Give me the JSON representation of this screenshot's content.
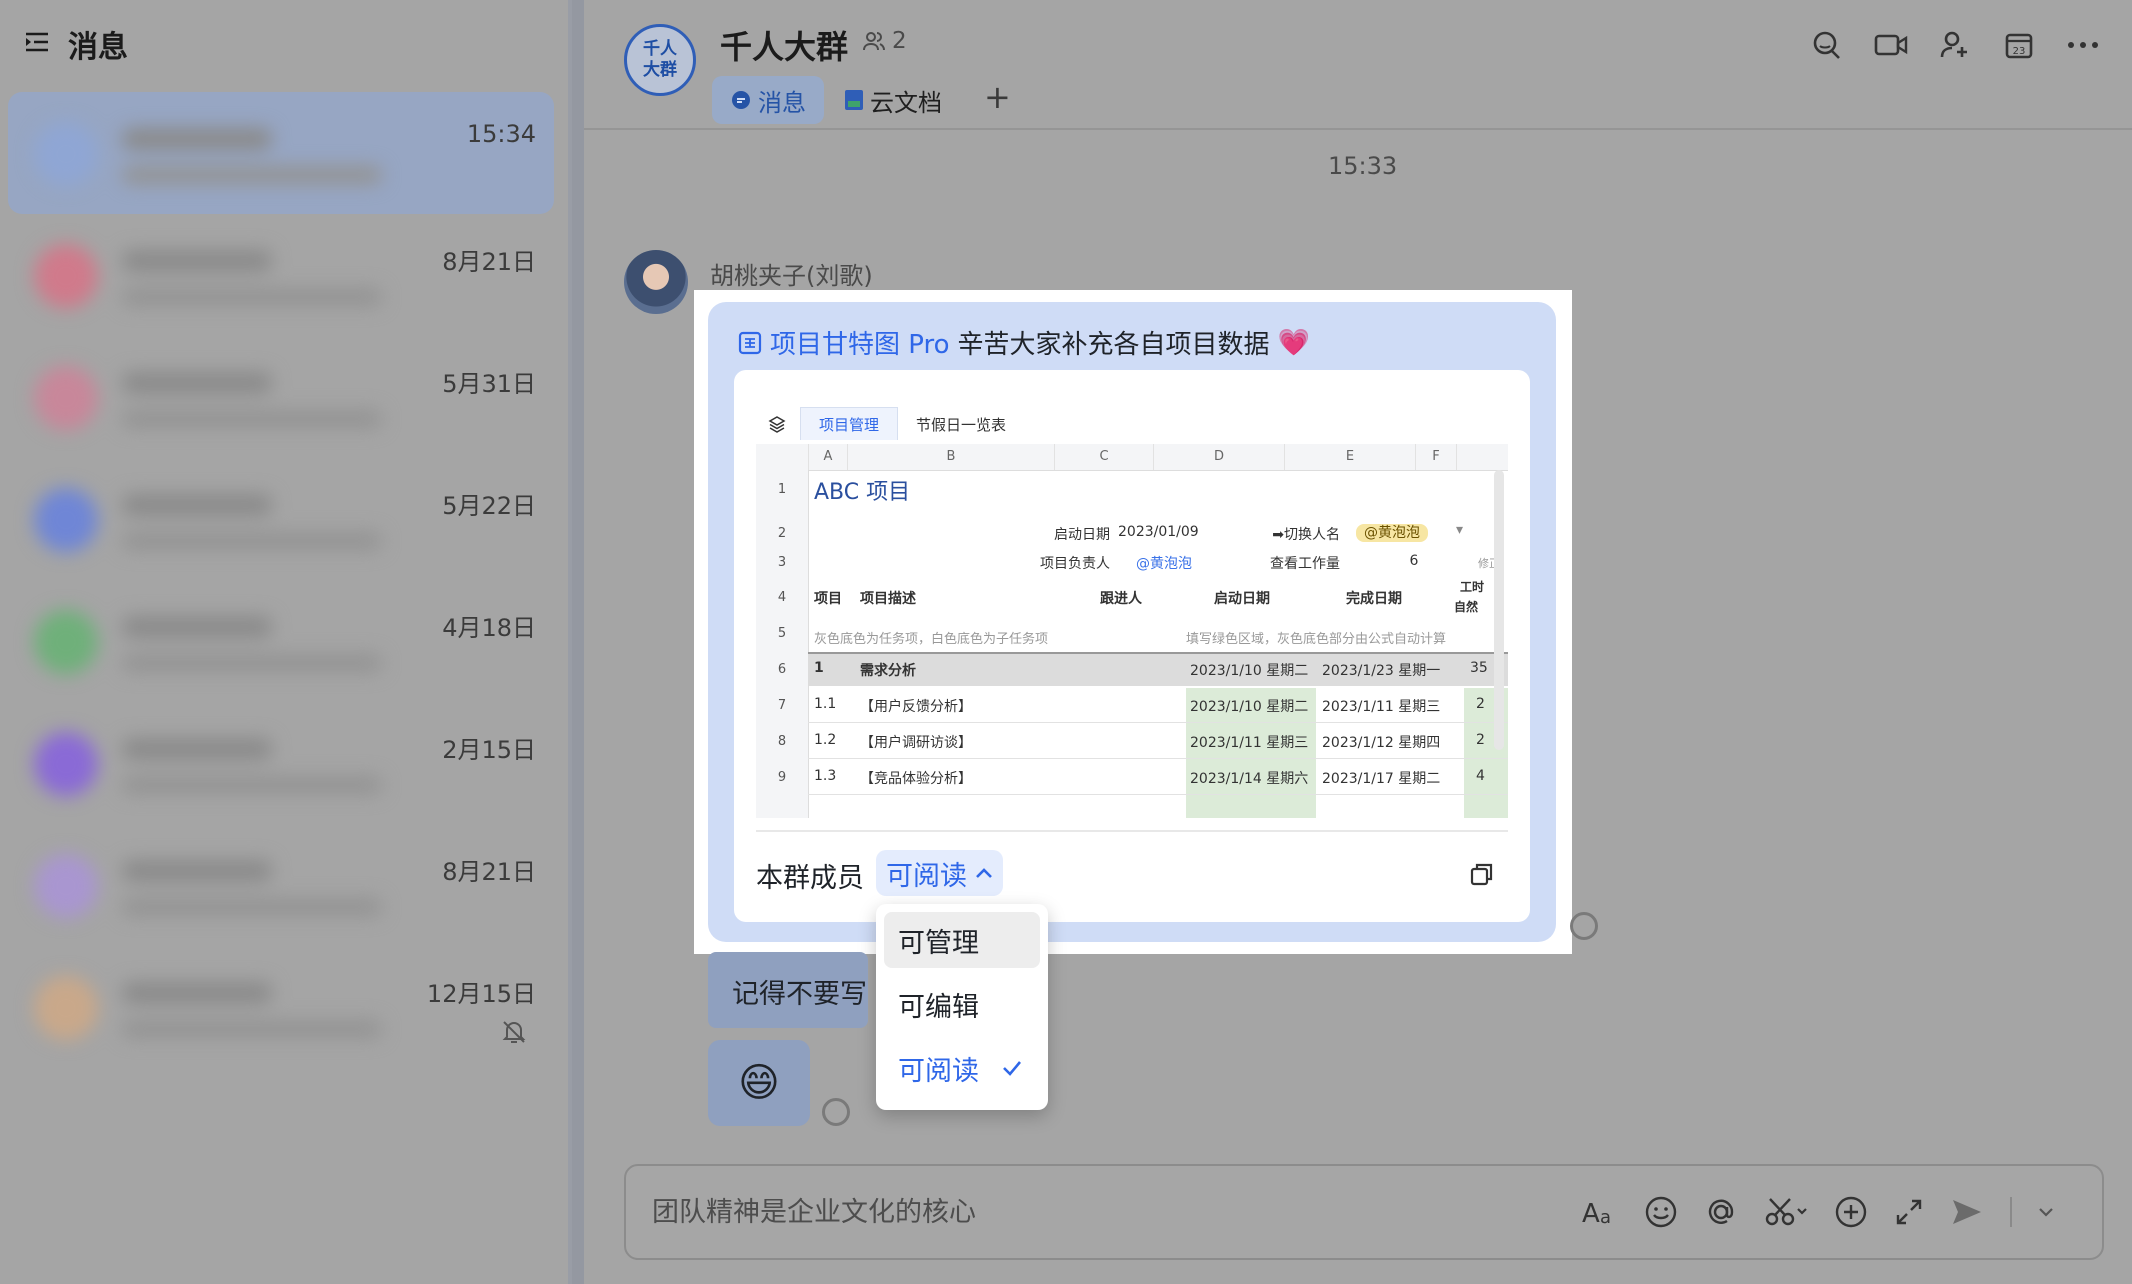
{
  "left": {
    "title": "消息",
    "chats": [
      {
        "time": "15:34",
        "active": true,
        "avatar": "#8fa6d4"
      },
      {
        "time": "8月21日",
        "avatar": "#d07a8b"
      },
      {
        "time": "5月31日",
        "avatar": "#c8879a"
      },
      {
        "time": "5月22日",
        "avatar": "#6f86d6"
      },
      {
        "time": "4月18日",
        "avatar": "#6fb07a"
      },
      {
        "time": "2月15日",
        "avatar": "#8a6ad6"
      },
      {
        "time": "8月21日",
        "avatar": "#a996d0"
      },
      {
        "time": "12月15日",
        "avatar": "#c9a88a",
        "muted": true
      }
    ]
  },
  "header": {
    "avatar_line1": "千人",
    "avatar_line2": "大群",
    "title": "千人大群",
    "member_count": "2",
    "tabs": [
      {
        "label": "消息",
        "active": true
      },
      {
        "label": "云文档",
        "active": false
      }
    ],
    "add": "+"
  },
  "chat": {
    "time_separator": "15:33",
    "sender": "胡桃夹子(刘歌)",
    "card": {
      "doc_name": "项目甘特图 Pro",
      "text": "辛苦大家补充各自项目数据",
      "emoji": "💗",
      "sheet_tabs": [
        "项目管理",
        "节假日一览表"
      ],
      "columns": [
        "A",
        "B",
        "C",
        "D",
        "E",
        "F"
      ],
      "sheet_title": "ABC 项目",
      "row2": {
        "label": "启动日期",
        "value": "2023/01/09",
        "switch_label": "➡切换人名",
        "person": "@黄泡泡"
      },
      "row3": {
        "label": "项目负责人",
        "value": "@黄泡泡",
        "workload_label": "查看工作量",
        "workload": "6",
        "extra": "修正"
      },
      "row4": {
        "c1": "项目",
        "c2": "项目描述",
        "c3": "跟进人",
        "c4": "启动日期",
        "c5": "完成日期",
        "c6": "工时",
        "c6b": "自然"
      },
      "row5": {
        "note1": "灰色底色为任务项，白色底色为子任务项",
        "note2": "填写绿色区域，灰色底色部分由公式自动计算"
      },
      "tasks": [
        {
          "no": "1",
          "name": "需求分析",
          "start": "2023/1/10 星期二",
          "end": "2023/1/23 星期一",
          "days": "35",
          "group": true
        },
        {
          "no": "1.1",
          "name": "【用户反馈分析】",
          "start": "2023/1/10 星期二",
          "end": "2023/1/11 星期三",
          "days": "2"
        },
        {
          "no": "1.2",
          "name": "【用户调研访谈】",
          "start": "2023/1/11 星期三",
          "end": "2023/1/12 星期四",
          "days": "2"
        },
        {
          "no": "1.3",
          "name": "【竞品体验分析】",
          "start": "2023/1/14 星期六",
          "end": "2023/1/17 星期二",
          "days": "4"
        }
      ],
      "row_numbers": [
        "1",
        "2",
        "3",
        "4",
        "5",
        "6",
        "7",
        "8",
        "9"
      ],
      "permission_label": "本群成员",
      "permission_value": "可阅读"
    },
    "dropdown": {
      "options": [
        "可管理",
        "可编辑",
        "可阅读"
      ],
      "selected": "可阅读"
    },
    "text_message_visible": "记得不要写",
    "emoji_message": "😄"
  },
  "composer": {
    "placeholder": "团队精神是企业文化的核心",
    "tools": [
      "font-icon",
      "emoji-icon",
      "mention-icon",
      "screenshot-icon",
      "plus-circle-icon",
      "expand-icon",
      "send-icon",
      "chevron-down-icon"
    ]
  },
  "colors": {
    "accent": "#2f67e8",
    "card_bg": "#cfdcf6",
    "active_chat": "#97a6c3"
  }
}
